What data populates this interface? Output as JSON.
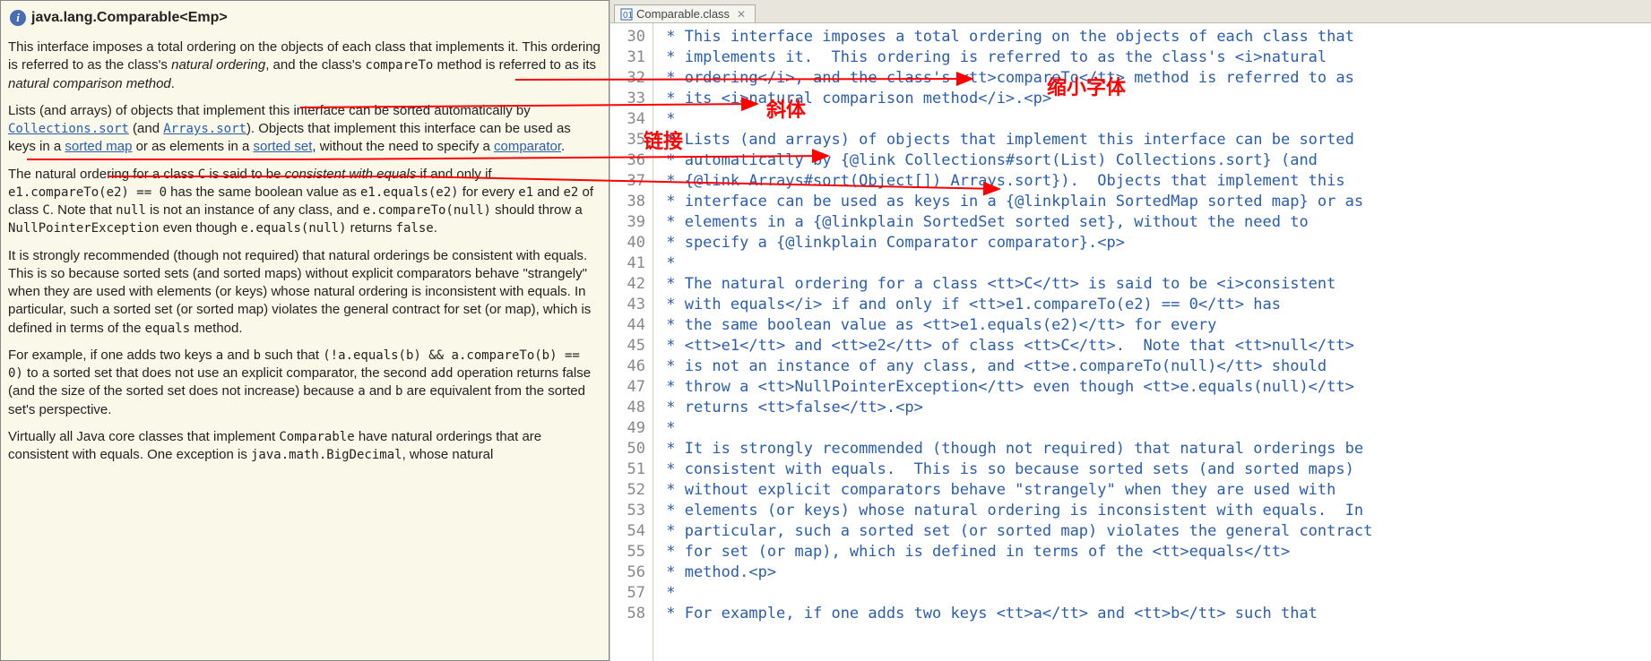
{
  "left": {
    "title": "java.lang.Comparable<Emp>",
    "p1_a": "This interface imposes a total ordering on the objects of each class that implements it. This ordering is referred to as the class's ",
    "p1_i1": "natural ordering",
    "p1_b": ", and the class's ",
    "p1_tt1": "compareTo",
    "p1_c": " method is referred to as its ",
    "p1_i2": "natural comparison method",
    "p1_d": ".",
    "p2_a": "Lists (and arrays) of objects that implement this interface can be sorted automatically by ",
    "p2_link1": "Collections.sort",
    "p2_b": " (and ",
    "p2_link2": "Arrays.sort",
    "p2_c": "). Objects that implement this interface can be used as keys in a ",
    "p2_link3": "sorted map",
    "p2_d": " or as elements in a ",
    "p2_link4": "sorted set",
    "p2_e": ", without the need to specify a ",
    "p2_link5": "comparator",
    "p2_f": ".",
    "p3_a": "The natural ordering for a class ",
    "p3_tt1": "C",
    "p3_b": " is said to be ",
    "p3_i1": "consistent with equals",
    "p3_c": " if and only if ",
    "p3_tt2": "e1.compareTo(e2) == 0",
    "p3_d": " has the same boolean value as ",
    "p3_tt3": "e1.equals(e2)",
    "p3_e": " for every ",
    "p3_tt4": "e1",
    "p3_f": " and ",
    "p3_tt5": "e2",
    "p3_g": " of class ",
    "p3_tt6": "C",
    "p3_h": ". Note that ",
    "p3_tt7": "null",
    "p3_i": " is not an instance of any class, and ",
    "p3_tt8": "e.compareTo(null)",
    "p3_j": " should throw a ",
    "p3_tt9": "NullPointerException",
    "p3_k": " even though ",
    "p3_tt10": "e.equals(null)",
    "p3_l": " returns ",
    "p3_tt11": "false",
    "p3_m": ".",
    "p4_a": "It is strongly recommended (though not required) that natural orderings be consistent with equals. This is so because sorted sets (and sorted maps) without explicit comparators behave \"strangely\" when they are used with elements (or keys) whose natural ordering is inconsistent with equals. In particular, such a sorted set (or sorted map) violates the general contract for set (or map), which is defined in terms of the ",
    "p4_tt1": "equals",
    "p4_b": " method.",
    "p5_a": "For example, if one adds two keys ",
    "p5_tt1": "a",
    "p5_b": " and ",
    "p5_tt2": "b",
    "p5_c": " such that ",
    "p5_tt3": "(!a.equals(b) && a.compareTo(b) == 0)",
    "p5_d": " to a sorted set that does not use an explicit comparator, the second ",
    "p5_tt4": "add",
    "p5_e": " operation returns false (and the size of the sorted set does not increase) because ",
    "p5_tt5": "a",
    "p5_f": " and ",
    "p5_tt6": "b",
    "p5_g": " are equivalent from the sorted set's perspective.",
    "p6_a": "Virtually all Java core classes that implement ",
    "p6_tt1": "Comparable",
    "p6_b": " have natural orderings that are consistent with equals. One exception is ",
    "p6_tt2": "java.math.BigDecimal",
    "p6_c": ", whose natural"
  },
  "right": {
    "tab_label": "Comparable.class",
    "tab_close": "✕",
    "lines": [
      {
        "n": "30",
        "t": " * This interface imposes a total ordering on the objects of each class that"
      },
      {
        "n": "31",
        "t": " * implements it.  This ordering is referred to as the class's <i>natural"
      },
      {
        "n": "32",
        "t": " * ordering</i>, and the class's <tt>compareTo</tt> method is referred to as"
      },
      {
        "n": "33",
        "t": " * its <i>natural comparison method</i>.<p>"
      },
      {
        "n": "34",
        "t": " *"
      },
      {
        "n": "35",
        "t": " * Lists (and arrays) of objects that implement this interface can be sorted"
      },
      {
        "n": "36",
        "t": " * automatically by {@link Collections#sort(List) Collections.sort} (and"
      },
      {
        "n": "37",
        "t": " * {@link Arrays#sort(Object[]) Arrays.sort}).  Objects that implement this"
      },
      {
        "n": "38",
        "t": " * interface can be used as keys in a {@linkplain SortedMap sorted map} or as"
      },
      {
        "n": "39",
        "t": " * elements in a {@linkplain SortedSet sorted set}, without the need to"
      },
      {
        "n": "40",
        "t": " * specify a {@linkplain Comparator comparator}.<p>"
      },
      {
        "n": "41",
        "t": " *"
      },
      {
        "n": "42",
        "t": " * The natural ordering for a class <tt>C</tt> is said to be <i>consistent"
      },
      {
        "n": "43",
        "t": " * with equals</i> if and only if <tt>e1.compareTo(e2) == 0</tt> has"
      },
      {
        "n": "44",
        "t": " * the same boolean value as <tt>e1.equals(e2)</tt> for every"
      },
      {
        "n": "45",
        "t": " * <tt>e1</tt> and <tt>e2</tt> of class <tt>C</tt>.  Note that <tt>null</tt>"
      },
      {
        "n": "46",
        "t": " * is not an instance of any class, and <tt>e.compareTo(null)</tt> should"
      },
      {
        "n": "47",
        "t": " * throw a <tt>NullPointerException</tt> even though <tt>e.equals(null)</tt>"
      },
      {
        "n": "48",
        "t": " * returns <tt>false</tt>.<p>"
      },
      {
        "n": "49",
        "t": " *"
      },
      {
        "n": "50",
        "t": " * It is strongly recommended (though not required) that natural orderings be"
      },
      {
        "n": "51",
        "t": " * consistent with equals.  This is so because sorted sets (and sorted maps)"
      },
      {
        "n": "52",
        "t": " * without explicit comparators behave \"strangely\" when they are used with"
      },
      {
        "n": "53",
        "t": " * elements (or keys) whose natural ordering is inconsistent with equals.  In"
      },
      {
        "n": "54",
        "t": " * particular, such a sorted set (or sorted map) violates the general contract"
      },
      {
        "n": "55",
        "t": " * for set (or map), which is defined in terms of the <tt>equals</tt>"
      },
      {
        "n": "56",
        "t": " * method.<p>"
      },
      {
        "n": "57",
        "t": " *"
      },
      {
        "n": "58",
        "t": " * For example, if one adds two keys <tt>a</tt> and <tt>b</tt> such that"
      }
    ]
  },
  "annotations": {
    "a1": "缩小字体",
    "a2": "斜体",
    "a3": "链接"
  }
}
